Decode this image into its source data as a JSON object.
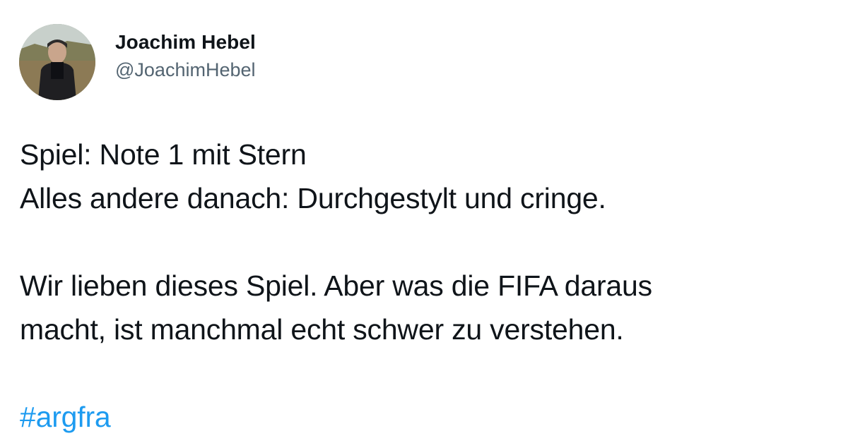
{
  "author": {
    "display_name": "Joachim Hebel",
    "handle": "@JoachimHebel"
  },
  "tweet": {
    "paragraphs": [
      [
        "Spiel: Note 1 mit Stern",
        "Alles andere danach: Durchgestylt und cringe."
      ],
      [
        "Wir lieben dieses Spiel. Aber was die FIFA daraus",
        "macht, ist manchmal echt schwer zu verstehen."
      ]
    ],
    "hashtag": "#argfra"
  },
  "colors": {
    "text": "#0f1419",
    "secondary_text": "#536471",
    "link": "#1d9bf0",
    "background": "#ffffff"
  },
  "icons": {
    "avatar": "avatar-photo"
  }
}
